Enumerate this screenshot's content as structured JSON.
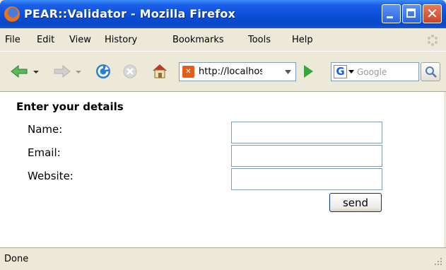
{
  "window": {
    "title": "PEAR::Validator - Mozilla Firefox"
  },
  "menubar": {
    "items": [
      "File",
      "Edit",
      "View",
      "History",
      "Bookmarks",
      "Tools",
      "Help"
    ]
  },
  "toolbar": {
    "url": "http://localhos",
    "search_placeholder": "Google",
    "icons": [
      "back-arrow-icon",
      "forward-arrow-icon",
      "reload-icon",
      "stop-icon",
      "home-icon",
      "site-favicon",
      "go-icon",
      "google-icon",
      "magnifier-icon"
    ]
  },
  "form": {
    "heading": "Enter your details",
    "fields": [
      {
        "label": "Name:",
        "value": ""
      },
      {
        "label": "Email:",
        "value": ""
      },
      {
        "label": "Website:",
        "value": ""
      }
    ],
    "submit_label": "send"
  },
  "status": {
    "text": "Done"
  }
}
